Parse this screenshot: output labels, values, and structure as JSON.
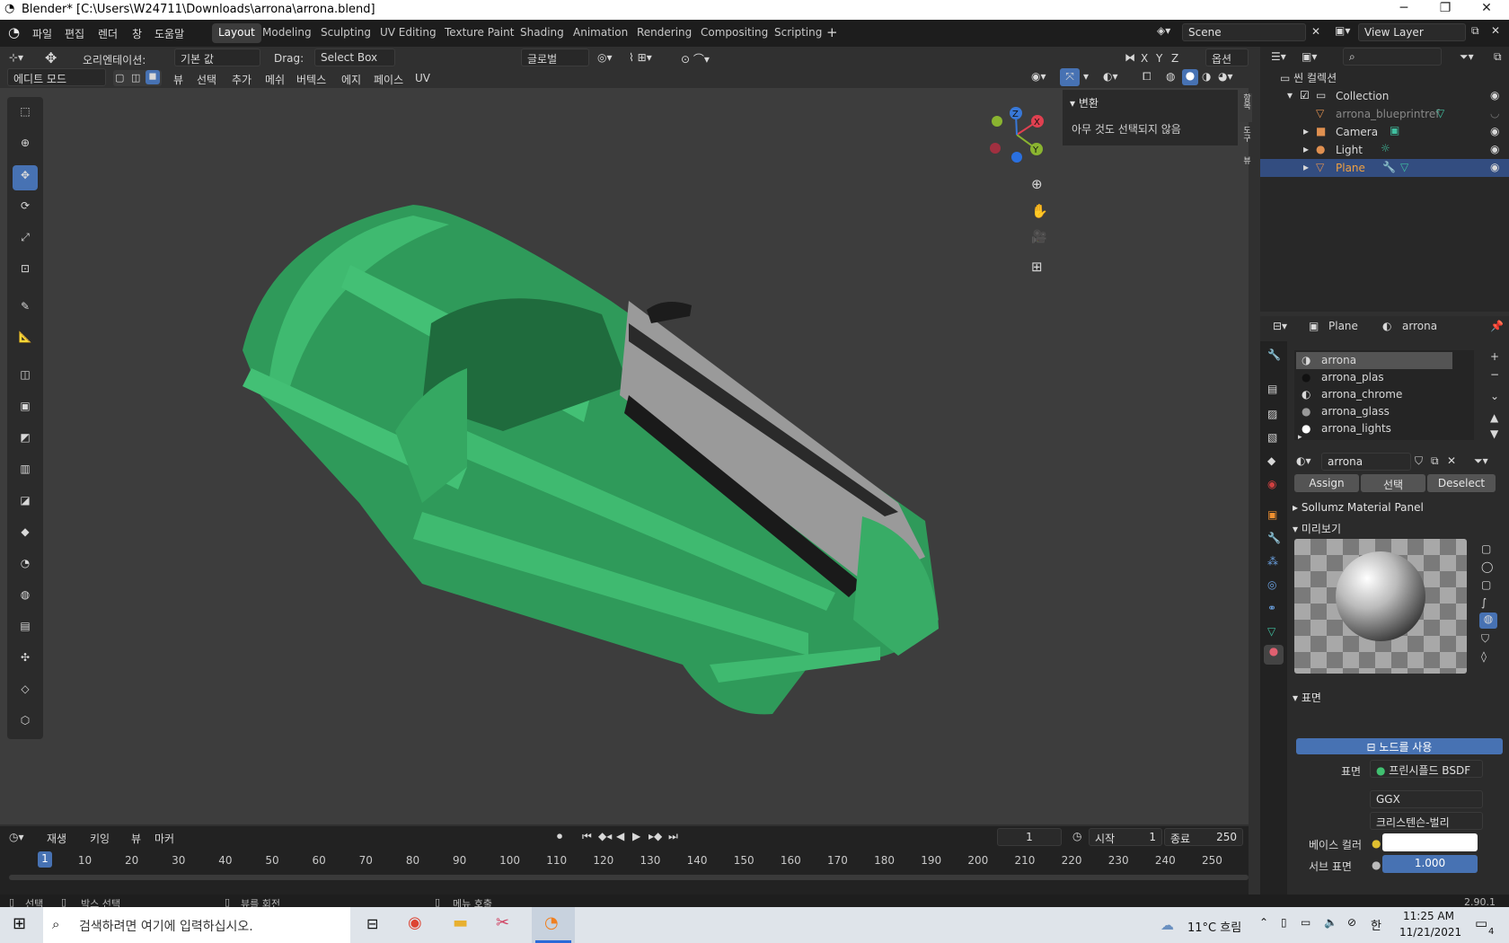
{
  "titlebar": {
    "title": "Blender* [C:\\Users\\W24711\\Downloads\\arrona\\arrona.blend]",
    "min": "─",
    "max": "❐",
    "close": "✕"
  },
  "menu": {
    "items": [
      "파일",
      "편집",
      "렌더",
      "창",
      "도움말"
    ]
  },
  "workspaces": [
    "Layout",
    "Modeling",
    "Sculpting",
    "UV Editing",
    "Texture Paint",
    "Shading",
    "Animation",
    "Rendering",
    "Compositing",
    "Scripting"
  ],
  "scene": {
    "label": "Scene",
    "view_layer": "View Layer"
  },
  "header": {
    "orientation_label": "오리엔테이션:",
    "orientation_value": "기본 값",
    "drag_label": "Drag:",
    "drag_value": "Select Box",
    "pivot": "글로벌",
    "xyz": [
      "X",
      "Y",
      "Z"
    ],
    "options": "옵션",
    "mode": "에디트 모드",
    "menus": [
      "뷰",
      "선택",
      "추가",
      "메쉬",
      "버텍스",
      "에지",
      "페이스",
      "UV"
    ]
  },
  "npanel": {
    "title": "변환",
    "empty_text": "아무 것도 선택되지 않음",
    "tabs": [
      "항목",
      "도구",
      "뷰"
    ]
  },
  "gizmo": {
    "x": "X",
    "y": "Y",
    "z": "Z"
  },
  "outliner": {
    "scene_collection": "씬 컬렉션",
    "items": [
      {
        "name": "Collection"
      },
      {
        "name": "arrona_blueprintref"
      },
      {
        "name": "Camera"
      },
      {
        "name": "Light"
      },
      {
        "name": "Plane"
      }
    ]
  },
  "props": {
    "object": "Plane",
    "material": "arrona",
    "slots": [
      "arrona",
      "arrona_plas",
      "arrona_chrome",
      "arrona_glass",
      "arrona_lights"
    ],
    "mat_field": "arrona",
    "assign": "Assign",
    "select": "선택",
    "deselect": "Deselect",
    "sollumz": "Sollumz Material Panel",
    "preview": "미리보기",
    "surface_section": "표면",
    "use_nodes": "노드를 사용",
    "surface_label": "표면",
    "surface_value": "프린시플드 BSDF",
    "distribution": "GGX",
    "subsurface_method": "크리스텐슨-벌리",
    "base_color_label": "베이스 컬러",
    "subsurface_label": "서브 표면",
    "subsurface_value": "1.000"
  },
  "timeline": {
    "menus": [
      "재생",
      "키잉",
      "뷰",
      "마커"
    ],
    "current": "1",
    "start_label": "시작",
    "start": "1",
    "end_label": "종료",
    "end": "250",
    "ticks": [
      "1",
      "10",
      "20",
      "30",
      "40",
      "50",
      "60",
      "70",
      "80",
      "90",
      "100",
      "110",
      "120",
      "130",
      "140",
      "150",
      "160",
      "170",
      "180",
      "190",
      "200",
      "210",
      "220",
      "230",
      "240",
      "250"
    ]
  },
  "status": {
    "select": "선택",
    "box_select": "박스 선택",
    "rotate_view": "뷰를 회전",
    "call_menu": "메뉴 호출",
    "version": "2.90.1"
  },
  "taskbar": {
    "search_placeholder": "검색하려면 여기에 입력하십시오.",
    "weather": "11°C 흐림",
    "ime": "한",
    "time": "11:25 AM",
    "date": "11/21/2021",
    "notif": "4"
  }
}
